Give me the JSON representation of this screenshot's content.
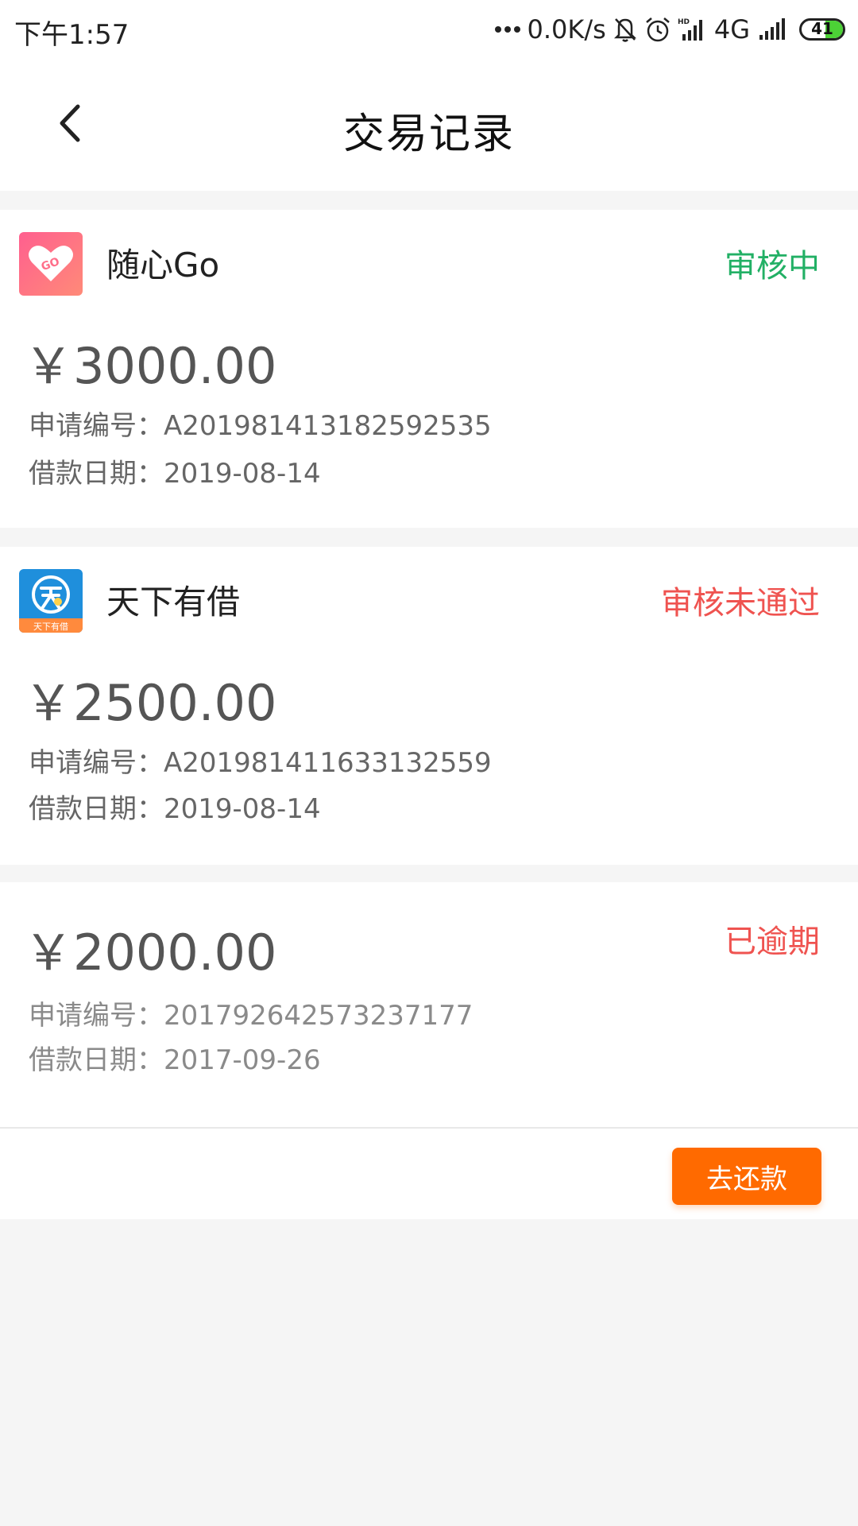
{
  "status_bar": {
    "time": "下午1:57",
    "network_speed": "0.0K/s",
    "network_type": "4G",
    "battery_level": "41",
    "icons": [
      "dots-icon",
      "mute-bell-icon",
      "alarm-icon",
      "hd-signal-icon",
      "signal-icon",
      "battery-icon"
    ]
  },
  "nav": {
    "back_icon": "chevron-left-icon",
    "title": "交易记录"
  },
  "records": [
    {
      "app_icon": "heart-go-icon",
      "app_name": "随心Go",
      "status": "审核中",
      "status_color": "#22b065",
      "amount": "￥3000.00",
      "apply_no": "申请编号：A201981413182592535",
      "loan_date": "借款日期：2019-08-14"
    },
    {
      "app_icon": "tianxia-logo-icon",
      "app_name": "天下有借",
      "status": "审核未通过",
      "status_color": "#ef5350",
      "amount": "￥2500.00",
      "apply_no": "申请编号：A201981411633132559",
      "loan_date": "借款日期：2019-08-14"
    },
    {
      "status": "已逾期",
      "status_color": "#ef5350",
      "amount": "￥2000.00",
      "apply_no": "申请编号：201792642573237177",
      "loan_date": "借款日期：2017-09-26",
      "action_label": "去还款",
      "action_color": "#ff6a00"
    }
  ]
}
